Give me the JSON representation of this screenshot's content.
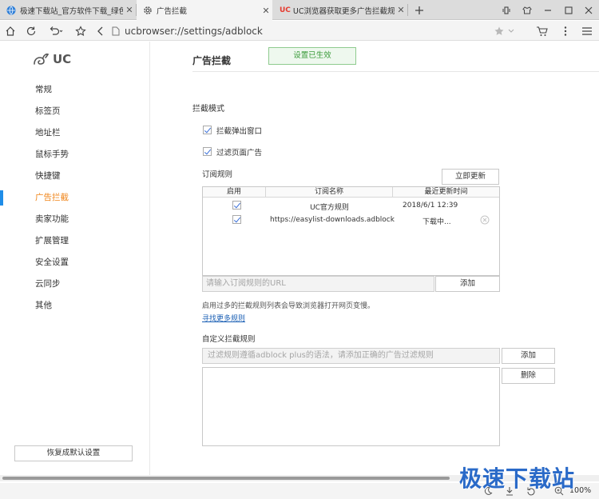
{
  "tabs": [
    {
      "title": "极速下载站_官方软件下载_绿色",
      "icon": "globe-icon",
      "active": false
    },
    {
      "title": "广告拦截",
      "icon": "gear-icon",
      "active": true
    },
    {
      "title": "UC浏览器获取更多广告拦截规",
      "icon": "uc-icon",
      "badge": "UC",
      "active": false
    }
  ],
  "address": "ucbrowser://settings/adblock",
  "sidebar": {
    "logo_text": "UC",
    "items": [
      {
        "label": "常规"
      },
      {
        "label": "标签页"
      },
      {
        "label": "地址栏"
      },
      {
        "label": "鼠标手势"
      },
      {
        "label": "快捷键"
      },
      {
        "label": "广告拦截",
        "active": true
      },
      {
        "label": "卖家功能"
      },
      {
        "label": "扩展管理"
      },
      {
        "label": "安全设置"
      },
      {
        "label": "云同步"
      },
      {
        "label": "其他"
      }
    ],
    "reset_label": "恢复成默认设置"
  },
  "main": {
    "title": "广告拦截",
    "status_label": "设置已生效",
    "mode_heading": "拦截模式",
    "checkbox_popup": "拦截弹出窗口",
    "checkbox_filter": "过滤页面广告",
    "sub_heading": "订阅规则",
    "update_button": "立即更新",
    "table_headers": [
      "启用",
      "订阅名称",
      "最近更新时间"
    ],
    "table_rows": [
      {
        "enabled": true,
        "name": "UC官方规则",
        "time": "2018/6/1 12:39"
      },
      {
        "enabled": true,
        "name": "https://easylist-downloads.adblockp...",
        "time": "下载中..."
      }
    ],
    "sub_input_placeholder": "请输入订阅规则的URL",
    "add_label": "添加",
    "warning_text": "启用过多的拦截规则列表会导致浏览器打开网页变慢。",
    "find_more_link": "寻找更多规则",
    "custom_heading": "自定义拦截规则",
    "custom_input_placeholder": "过滤规则遵循adblock plus的语法，请添加正确的广告过滤规则",
    "custom_add_label": "添加",
    "delete_label": "删除"
  },
  "statusbar": {
    "zoom": "100%"
  },
  "watermark": "极速下载站",
  "colors": {
    "accent": "#f08418",
    "active_bar": "#1f8de8",
    "link": "#1a5fb4",
    "status_border": "#8fcb8f",
    "status_bg": "#eef8ee"
  }
}
